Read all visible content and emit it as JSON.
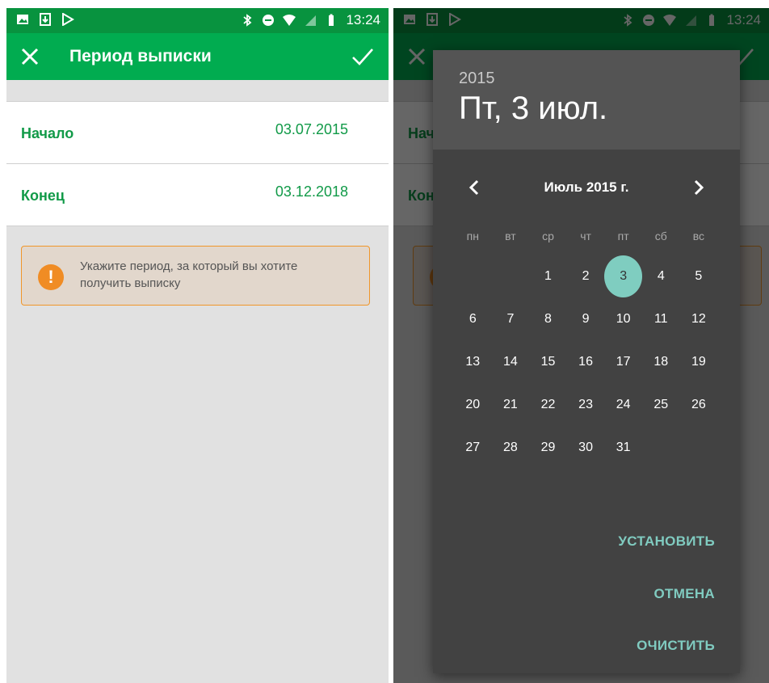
{
  "status_bar": {
    "time": "13:24"
  },
  "app_bar": {
    "title": "Период выписки"
  },
  "period": {
    "start_label": "Начало",
    "start_value": "03.07.2015",
    "end_label": "Конец",
    "end_value": "03.12.2018"
  },
  "notice": {
    "text": "Укажите период, за который вы хотите получить выписку"
  },
  "date_picker": {
    "selected_year": "2015",
    "selected_date": "Пт, 3 июл.",
    "month_title": "Июль 2015 г.",
    "weekdays": [
      "пн",
      "вт",
      "ср",
      "чт",
      "пт",
      "сб",
      "вс"
    ],
    "days": [
      "1",
      "2",
      "3",
      "4",
      "5",
      "6",
      "7",
      "8",
      "9",
      "10",
      "11",
      "12",
      "13",
      "14",
      "15",
      "16",
      "17",
      "18",
      "19",
      "20",
      "21",
      "22",
      "23",
      "24",
      "25",
      "26",
      "27",
      "28",
      "29",
      "30",
      "31"
    ],
    "selected_day": "3",
    "buttons": {
      "set": "УСТАНОВИТЬ",
      "cancel": "ОТМЕНА",
      "clear": "ОЧИСТИТЬ"
    }
  },
  "colors": {
    "status_bar": "#08933f",
    "app_bar": "#01ac50",
    "accent_green": "#119a48",
    "warning": "#f08c24",
    "dialog_bg": "#424242",
    "selected_day": "#7fcdc0"
  }
}
